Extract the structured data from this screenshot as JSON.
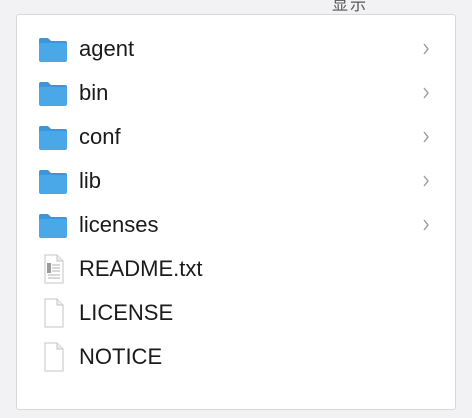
{
  "header": {
    "partial_label": "显示"
  },
  "items": [
    {
      "label": "agent",
      "kind": "folder",
      "icon": "folder-icon",
      "expandable": true
    },
    {
      "label": "bin",
      "kind": "folder",
      "icon": "folder-icon",
      "expandable": true
    },
    {
      "label": "conf",
      "kind": "folder",
      "icon": "folder-icon",
      "expandable": true
    },
    {
      "label": "lib",
      "kind": "folder",
      "icon": "folder-icon",
      "expandable": true
    },
    {
      "label": "licenses",
      "kind": "folder",
      "icon": "folder-icon",
      "expandable": true
    },
    {
      "label": "README.txt",
      "kind": "text-file",
      "icon": "text-document-icon",
      "expandable": false
    },
    {
      "label": "LICENSE",
      "kind": "file",
      "icon": "blank-document-icon",
      "expandable": false
    },
    {
      "label": "NOTICE",
      "kind": "file",
      "icon": "blank-document-icon",
      "expandable": false
    }
  ],
  "colors": {
    "folder": "#4aa8e8",
    "folder_tab": "#3b97d9",
    "chevron": "#9a9a9a",
    "text": "#1a1a1a"
  }
}
